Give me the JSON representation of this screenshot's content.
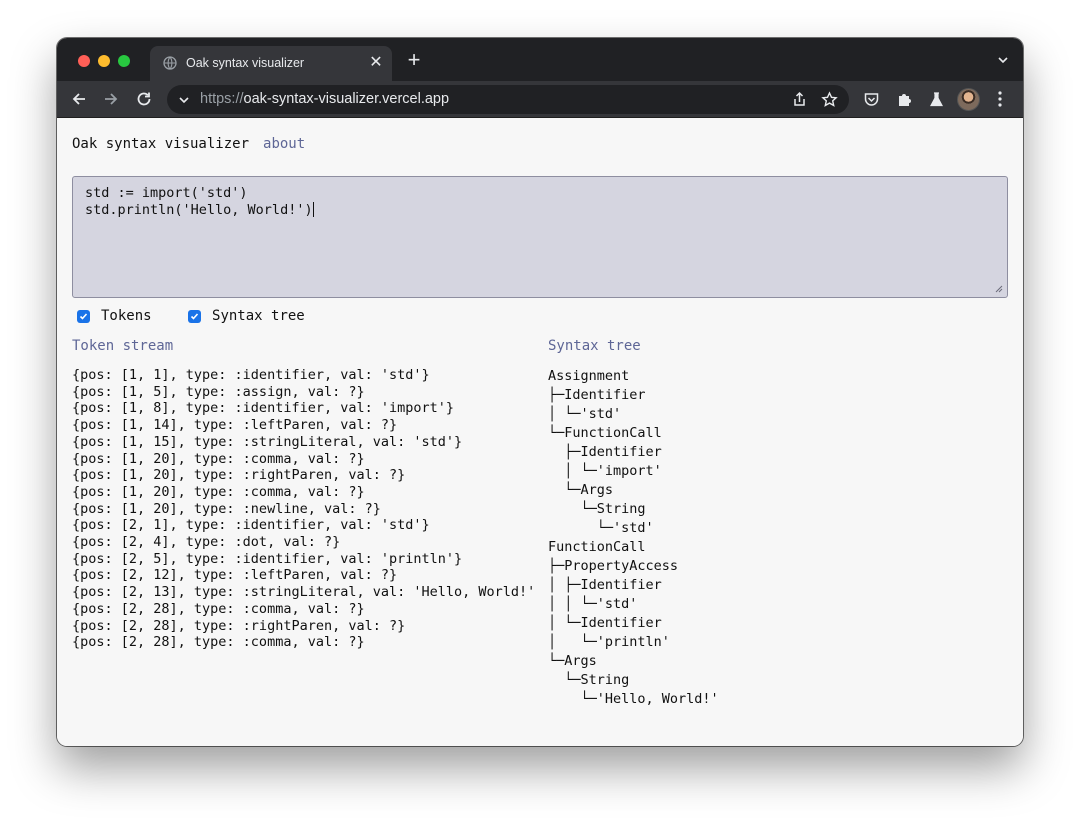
{
  "browser": {
    "tab_title": "Oak syntax visualizer",
    "url_scheme": "https://",
    "url_host": "oak-syntax-visualizer.vercel.app"
  },
  "header": {
    "title": "Oak syntax visualizer",
    "about_link": "about"
  },
  "editor": {
    "lines": [
      "std := import('std')",
      "std.println('Hello, World!')"
    ]
  },
  "options": {
    "tokens_label": "Tokens",
    "tokens_checked": true,
    "tree_label": "Syntax tree",
    "tree_checked": true
  },
  "token_stream": {
    "title": "Token stream",
    "items": [
      "{pos: [1, 1], type: :identifier, val: 'std'}",
      "{pos: [1, 5], type: :assign, val: ?}",
      "{pos: [1, 8], type: :identifier, val: 'import'}",
      "{pos: [1, 14], type: :leftParen, val: ?}",
      "{pos: [1, 15], type: :stringLiteral, val: 'std'}",
      "{pos: [1, 20], type: :comma, val: ?}",
      "{pos: [1, 20], type: :rightParen, val: ?}",
      "{pos: [1, 20], type: :comma, val: ?}",
      "{pos: [1, 20], type: :newline, val: ?}",
      "{pos: [2, 1], type: :identifier, val: 'std'}",
      "{pos: [2, 4], type: :dot, val: ?}",
      "{pos: [2, 5], type: :identifier, val: 'println'}",
      "{pos: [2, 12], type: :leftParen, val: ?}",
      "{pos: [2, 13], type: :stringLiteral, val: 'Hello, World!'",
      "{pos: [2, 28], type: :comma, val: ?}",
      "{pos: [2, 28], type: :rightParen, val: ?}",
      "{pos: [2, 28], type: :comma, val: ?}"
    ]
  },
  "syntax_tree": {
    "title": "Syntax tree",
    "lines": [
      "Assignment",
      "├─Identifier",
      "│ └─'std'",
      "└─FunctionCall",
      "  ├─Identifier",
      "  │ └─'import'",
      "  └─Args",
      "    └─String",
      "      └─'std'",
      "FunctionCall",
      "├─PropertyAccess",
      "│ ├─Identifier",
      "│ │ └─'std'",
      "│ └─Identifier",
      "│   └─'println'",
      "└─Args",
      "  └─String",
      "    └─'Hello, World!'"
    ]
  },
  "colors": {
    "link": "#5e6696",
    "editor_bg": "#d5d5e0",
    "checkbox": "#1a73e8"
  },
  "icons": {
    "tab": "globe-icon",
    "toolbar": [
      "back-arrow-icon",
      "forward-arrow-icon",
      "reload-icon",
      "share-icon",
      "star-icon",
      "pocket-icon",
      "puzzle-icon",
      "flask-icon",
      "kebab-menu-icon"
    ]
  }
}
